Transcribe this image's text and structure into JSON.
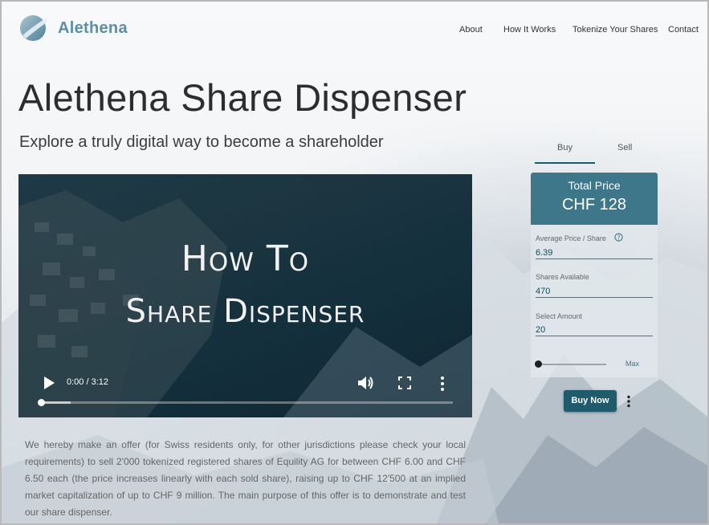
{
  "header": {
    "brand": "Alethena",
    "nav": [
      {
        "label": "About"
      },
      {
        "label": "How It Works"
      },
      {
        "label": "Tokenize Your Shares"
      },
      {
        "label": "Contact"
      }
    ]
  },
  "hero": {
    "title": "Alethena Share Dispenser",
    "subtitle": "Explore a truly digital way to become a shareholder"
  },
  "video": {
    "title_line1": "How To",
    "title_line2": "Share Dispenser",
    "time": "0:00 / 3:12",
    "progress": 0.0
  },
  "description": "We hereby make an offer (for Swiss residents only, for other jurisdictions please check your local requirements) to sell 2'000 tokenized registered shares of Equility AG for between CHF 6.00 and CHF 6.50 each (the price increases linearly with each sold share), raising up to CHF 12'500 at an implied market capitalization of up to CHF 9 million. The main purpose of this offer is to demonstrate and test our share dispenser.",
  "trade": {
    "tabs": [
      {
        "label": "Buy",
        "active": true
      },
      {
        "label": "Sell",
        "active": false
      }
    ],
    "total_price_label": "Total Price",
    "total_price_value": "CHF 128",
    "fields": {
      "avg_price_label": "Average Price / Share",
      "avg_price_value": "6.39",
      "shares_available_label": "Shares Available",
      "shares_available_value": "470",
      "select_amount_label": "Select Amount",
      "select_amount_value": "20"
    },
    "slider_max_label": "Max",
    "buy_button": "Buy Now"
  },
  "colors": {
    "brand": "#5c8fa3",
    "panel_header": "#3d7789",
    "button": "#1f5a6d"
  }
}
